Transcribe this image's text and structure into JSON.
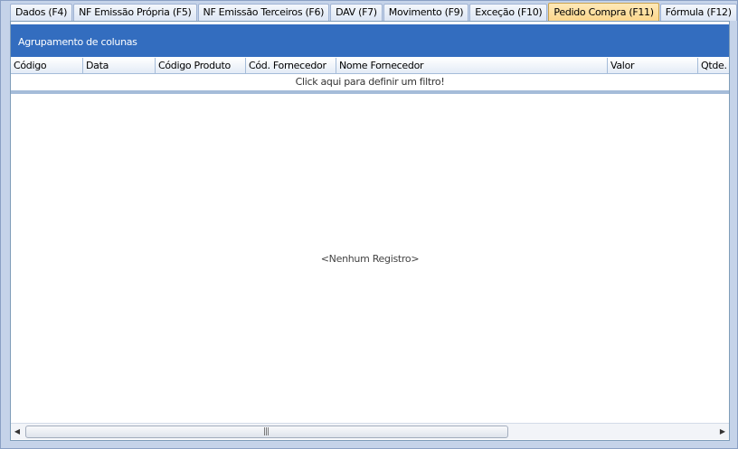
{
  "tabs": [
    {
      "label": "Dados (F4)",
      "active": false
    },
    {
      "label": "NF Emissão Própria (F5)",
      "active": false
    },
    {
      "label": "NF Emissão Terceiros (F6)",
      "active": false
    },
    {
      "label": "DAV (F7)",
      "active": false
    },
    {
      "label": "Movimento (F9)",
      "active": false
    },
    {
      "label": "Exceção (F10)",
      "active": false
    },
    {
      "label": "Pedido Compra (F11)",
      "active": true
    },
    {
      "label": "Fórmula (F12)",
      "active": false
    }
  ],
  "grid": {
    "group_panel_text": "Agrupamento de colunas",
    "columns": [
      {
        "label": "Código"
      },
      {
        "label": "Data"
      },
      {
        "label": "Código Produto"
      },
      {
        "label": "Cód. Fornecedor"
      },
      {
        "label": "Nome Fornecedor"
      },
      {
        "label": "Valor"
      },
      {
        "label": "Qtde."
      }
    ],
    "filter_row_text": "Click aqui para definir um filtro!",
    "empty_text": "<Nenhum Registro>",
    "scrollbar": {
      "left_icon": "triangle-left-icon",
      "right_icon": "triangle-right-icon",
      "grip_icon": "grip-lines-icon"
    }
  },
  "colors": {
    "accent": "#336dbf",
    "active_tab": "#fbd68a",
    "background": "#c5d3e9"
  }
}
